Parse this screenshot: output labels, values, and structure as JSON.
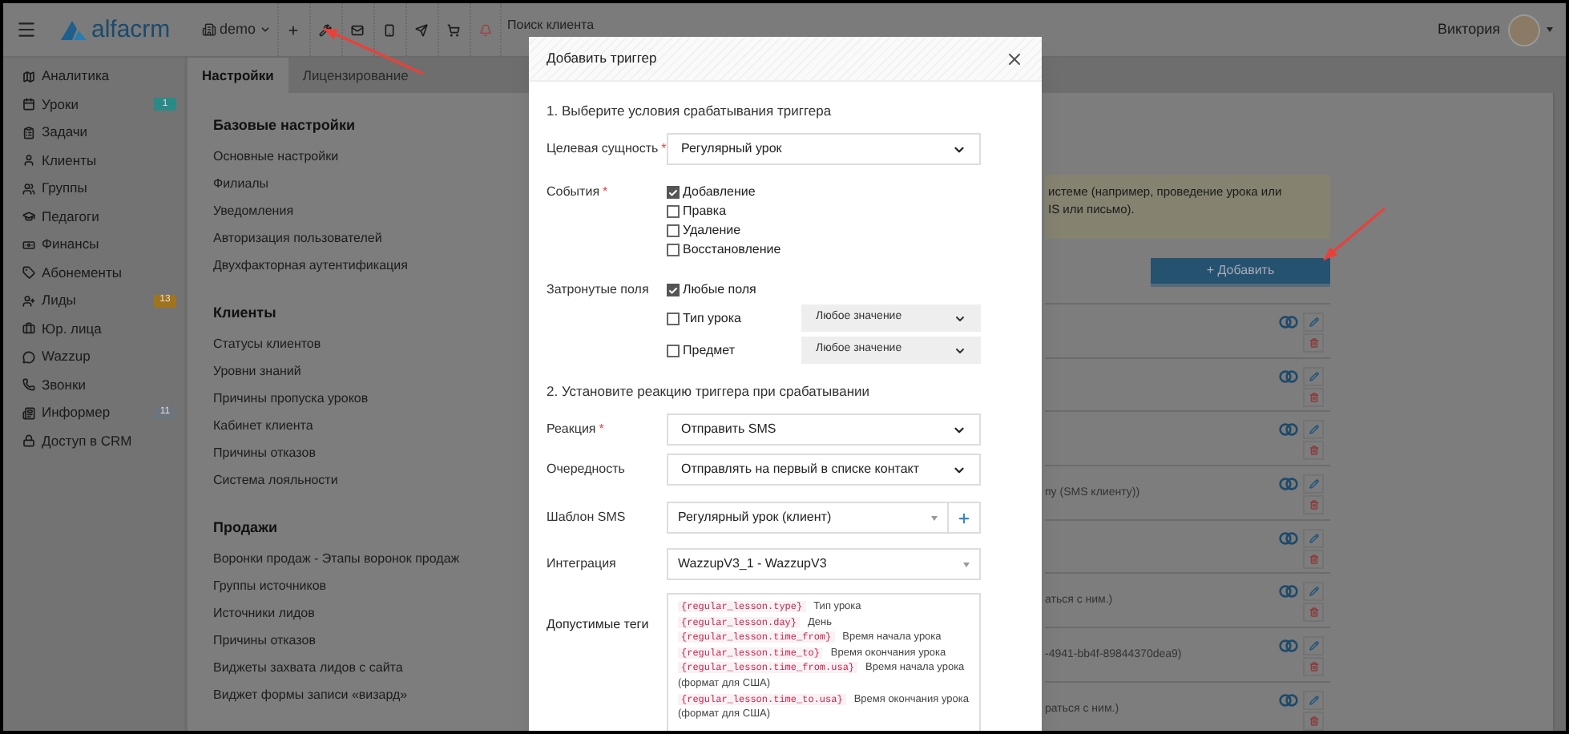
{
  "topbar": {
    "logo": "alfacrm",
    "branch": "demo",
    "search": {
      "placeholder": "Поиск клиента"
    },
    "user": "Виктория"
  },
  "sidebar": {
    "items": [
      {
        "label": "Аналитика"
      },
      {
        "label": "Уроки",
        "badge": {
          "text": "1",
          "color": "#2a8a86"
        }
      },
      {
        "label": "Задачи"
      },
      {
        "label": "Клиенты"
      },
      {
        "label": "Группы"
      },
      {
        "label": "Педагоги"
      },
      {
        "label": "Финансы"
      },
      {
        "label": "Абонементы"
      },
      {
        "label": "Лиды",
        "badge": {
          "text": "13",
          "color": "#a0741e"
        }
      },
      {
        "label": "Юр. лица"
      },
      {
        "label": "Wazzup"
      },
      {
        "label": "Звонки"
      },
      {
        "label": "Информер",
        "badge": {
          "text": "11",
          "color": "#6c747c"
        }
      },
      {
        "label": "Доступ в CRM"
      }
    ]
  },
  "tabs": [
    {
      "label": "Настройки",
      "selected": true
    },
    {
      "label": "Лицензирование",
      "selected": false
    }
  ],
  "settings": [
    {
      "title": "Базовые настройки",
      "items": [
        "Основные настройки",
        "Филиалы",
        "Уведомления",
        "Авторизация пользователей",
        "Двухфакторная аутентификация"
      ]
    },
    {
      "title": "Клиенты",
      "items": [
        "Статусы клиентов",
        "Уровни знаний",
        "Причины пропуска уроков",
        "Кабинет клиента",
        "Причины отказов",
        "Система лояльности"
      ]
    },
    {
      "title": "Продажи",
      "items": [
        "Воронки продаж - Этапы воронок продаж",
        "Группы источников",
        "Источники лидов",
        "Причины отказов",
        "Виджеты захвата лидов с сайта",
        "Виджет формы записи «визард»"
      ]
    }
  ],
  "notice": {
    "lines": [
      "истеме (например, проведение урока или",
      "IS или письмо)."
    ]
  },
  "add_button": "+ Добавить",
  "triggers": [
    {
      "kind": "trigger"
    },
    {
      "kind": "trigger"
    },
    {
      "kind": "trigger"
    },
    {
      "kind": "trigger",
      "description": "пу (SMS клиенту))"
    },
    {
      "kind": "trigger"
    },
    {
      "kind": "trigger",
      "description": "аться с ним.)"
    },
    {
      "kind": "trigger",
      "description": "-4941-bb4f-89844370dea9)"
    },
    {
      "kind": "trigger",
      "description": "раться с ним.)"
    }
  ],
  "modal": {
    "title": "Добавить триггер",
    "section_1": "1. Выберите условия срабатывания триггера",
    "target": {
      "label": "Целевая сущность",
      "mark": "*",
      "value": "Регулярный урок"
    },
    "events": {
      "label": "События",
      "mark": "*",
      "options": [
        {
          "label": "Добавление",
          "checked": true
        },
        {
          "label": "Правка",
          "checked": false
        },
        {
          "label": "Удаление",
          "checked": false
        },
        {
          "label": "Восстановление",
          "checked": false
        }
      ]
    },
    "fields": {
      "label": "Затронутые поля",
      "options": [
        {
          "label": "Любые поля",
          "checked": true
        },
        {
          "label": "Тип урока",
          "checked": false,
          "value": "Любое значение"
        },
        {
          "label": "Предмет",
          "checked": false,
          "value": "Любое значение"
        }
      ]
    },
    "section_2": "2. Установите реакцию триггера при срабатывании",
    "reaction": [
      {
        "label": "Реакция",
        "mark": "*",
        "kind": "select",
        "value": "Отправить SMS"
      },
      {
        "label": "Очередность",
        "kind": "select",
        "value": "Отправлять на первый в списке контакт"
      },
      {
        "label": "Шаблон SMS",
        "kind": "combo-add",
        "value": "Регулярный урок (клиент)"
      },
      {
        "label": "Интеграция",
        "kind": "combo",
        "value": "WazzupV3_1 - WazzupV3"
      }
    ],
    "tags": {
      "label": "Допустимые теги",
      "items": [
        {
          "code": "{regular_lesson.type}",
          "description": "Тип урока"
        },
        {
          "code": "{regular_lesson.day}",
          "description": "День"
        },
        {
          "code": "{regular_lesson.time_from}",
          "description": "Время начала урока"
        },
        {
          "code": "{regular_lesson.time_to}",
          "description": "Время окончания урока"
        },
        {
          "code": "{regular_lesson.time_from.usa}",
          "description": "Время начала урока (формат для США)"
        },
        {
          "code": "{regular_lesson.time_to.usa}",
          "description": "Время окончания урока (формат для США)"
        }
      ]
    }
  }
}
